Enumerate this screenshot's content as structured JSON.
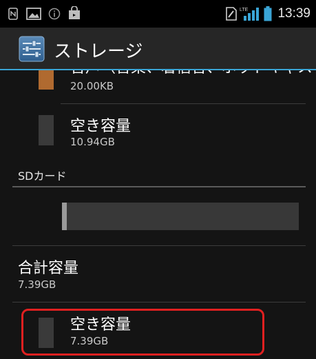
{
  "status_bar": {
    "time": "13:39",
    "left_icons": [
      "nfc-icon",
      "image-icon",
      "info-icon",
      "shopping-bag-icon"
    ],
    "right_icons": [
      "sim-card-icon",
      "lte-signal-icon",
      "battery-icon"
    ],
    "signal_label": "LTE"
  },
  "action_bar": {
    "title": "ストレージ",
    "icon": "settings-sliders-icon"
  },
  "storage_items": [
    {
      "title": "音声（音楽、着信音、ポッドキャストなど）",
      "size": "20.00KB",
      "color": "#b06a30"
    },
    {
      "title": "空き容量",
      "size": "10.94GB",
      "color": "#3a3a3a"
    }
  ],
  "sd_section": {
    "header": "SDカード",
    "usage_fraction": 0.02,
    "total_title": "合計容量",
    "total_size": "7.39GB",
    "free_title": "空き容量",
    "free_size": "7.39GB",
    "free_color": "#3a3a3a"
  },
  "colors": {
    "accent": "#3aa5d6",
    "highlight": "#e02020",
    "battery": "#3aa5d6"
  }
}
